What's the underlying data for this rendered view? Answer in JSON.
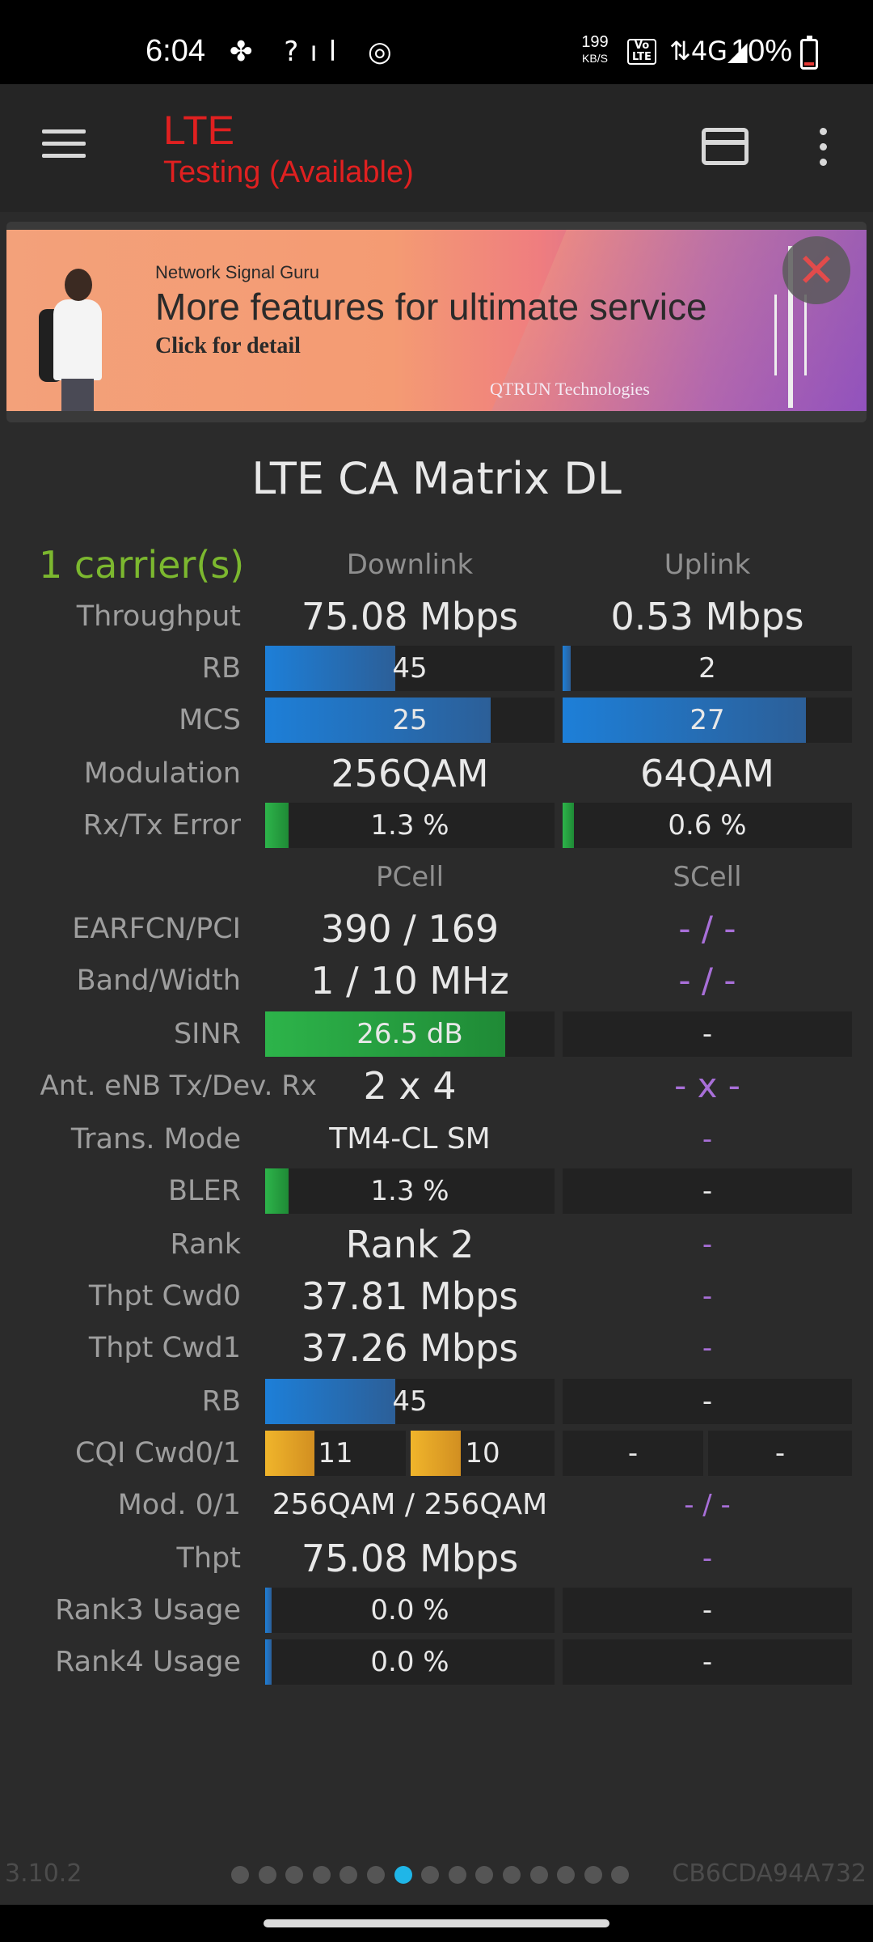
{
  "status_bar": {
    "time": "6:04",
    "left_icons": "✤ ?ıl ◎",
    "speed_value": "199",
    "speed_unit": "KB/S",
    "volte": "Vo LTE",
    "network": "⇅4G◢",
    "battery": "10%"
  },
  "app_bar": {
    "title": "LTE",
    "subtitle": "Testing (Available)",
    "menu_icon": "hamburger-menu",
    "card_icon": "card",
    "more_icon": "more-vertical"
  },
  "banner": {
    "brand": "Network Signal Guru",
    "headline": "More features for ultimate service",
    "cta": "Click for detail",
    "company": "QTRUN Technologies",
    "close": "✕"
  },
  "main": {
    "title": "LTE CA Matrix DL",
    "carriers": "1 carrier(s)",
    "headers": {
      "downlink": "Downlink",
      "uplink": "Uplink",
      "pcell": "PCell",
      "scell": "SCell"
    },
    "labels": {
      "throughput": "Throughput",
      "rb": "RB",
      "mcs": "MCS",
      "modulation": "Modulation",
      "rxtx_error": "Rx/Tx Error",
      "earfcn_pci": "EARFCN/PCI",
      "band_width": "Band/Width",
      "sinr": "SINR",
      "ant": "Ant. eNB Tx/Dev. Rx",
      "trans_mode": "Trans. Mode",
      "bler": "BLER",
      "rank": "Rank",
      "thpt_cwd0": "Thpt Cwd0",
      "thpt_cwd1": "Thpt Cwd1",
      "rb2": "RB",
      "cqi": "CQI Cwd0/1",
      "mod01": "Mod. 0/1",
      "thpt": "Thpt",
      "rank3": "Rank3 Usage",
      "rank4": "Rank4 Usage"
    },
    "downlink": {
      "throughput": "75.08 Mbps",
      "rb": "45",
      "rb_level": 0.45,
      "mcs": "25",
      "mcs_level": 0.78,
      "modulation": "256QAM",
      "error": "1.3 %",
      "error_level": 0.08
    },
    "uplink": {
      "throughput": "0.53 Mbps",
      "rb": "2",
      "rb_level": 0.02,
      "mcs": "27",
      "mcs_level": 0.84,
      "modulation": "64QAM",
      "error": "0.6 %",
      "error_level": 0.04
    },
    "pcell": {
      "earfcn_pci": "390 / 169",
      "band_width": "1 / 10 MHz",
      "sinr": "26.5 dB",
      "sinr_level": 0.83,
      "ant": "2 x 4",
      "trans_mode": "TM4-CL SM",
      "bler": "1.3 %",
      "bler_level": 0.08,
      "rank": "Rank 2",
      "thpt_cwd0": "37.81 Mbps",
      "thpt_cwd1": "37.26 Mbps",
      "rb": "45",
      "rb_level": 0.45,
      "cqi0": "11",
      "cqi1": "10",
      "cqi0_level": 0.35,
      "cqi1_level": 0.35,
      "mod01": "256QAM / 256QAM",
      "thpt": "75.08 Mbps",
      "rank3": "0.0 %",
      "rank3_level": 0.02,
      "rank4": "0.0 %",
      "rank4_level": 0.02
    },
    "scell": {
      "earfcn_pci": "- / -",
      "band_width": "- / -",
      "sinr": "-",
      "ant": "- x -",
      "trans_mode": "-",
      "bler": "-",
      "rank": "-",
      "thpt_cwd0": "-",
      "thpt_cwd1": "-",
      "rb": "-",
      "cqi0": "-",
      "cqi1": "-",
      "mod01": "- / -",
      "thpt": "-",
      "rank3": "-",
      "rank4": "-"
    }
  },
  "footer": {
    "version": "3.10.2",
    "page_count": 15,
    "active_page": 7,
    "device_id": "CB6CDA94A732"
  }
}
